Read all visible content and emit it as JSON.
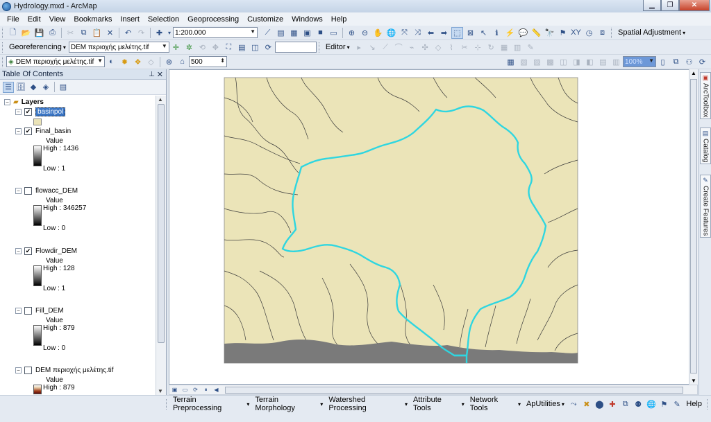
{
  "window": {
    "title": "Hydrology.mxd - ArcMap"
  },
  "menu": [
    "File",
    "Edit",
    "View",
    "Bookmarks",
    "Insert",
    "Selection",
    "Geoprocessing",
    "Customize",
    "Windows",
    "Help"
  ],
  "toolbar": {
    "scale": "1:200.000",
    "spatial_adjustment": "Spatial Adjustment",
    "georeferencing": "Georeferencing",
    "georef_layer": "DEM περιοχής μελέτης.tif",
    "editor": "Editor",
    "active_layer": "DEM περιοχής μελέτης.tif",
    "contour_interval": "500",
    "zoom_value": "100%"
  },
  "toc": {
    "title": "Table Of Contents",
    "root": "Layers",
    "layers": [
      {
        "name": "basinpol",
        "checked": true
      },
      {
        "name": "Final_basin",
        "checked": true,
        "value_label": "Value",
        "high": "High : 1436",
        "low": "Low : 1"
      },
      {
        "name": "flowacc_DEM",
        "checked": false,
        "value_label": "Value",
        "high": "High : 346257",
        "low": "Low : 0"
      },
      {
        "name": "Flowdir_DEM",
        "checked": true,
        "value_label": "Value",
        "high": "High : 128",
        "low": "Low : 1"
      },
      {
        "name": "Fill_DEM",
        "checked": false,
        "value_label": "Value",
        "high": "High : 879",
        "low": "Low : 0"
      },
      {
        "name": "DEM περιοχής μελέτης.tif",
        "checked": false,
        "value_label": "Value",
        "high": "High : 879"
      }
    ]
  },
  "dock": {
    "tab1": "ArcToolbox",
    "tab2": "Catalog",
    "tab3": "Create Features"
  },
  "hydro_toolbar": [
    "Terrain Preprocessing",
    "Terrain Morphology",
    "Watershed Processing",
    "Attribute Tools",
    "Network Tools",
    "ApUtilities"
  ],
  "help": "Help",
  "colors": {
    "map_bg": "#ebe4b8",
    "basin_outline": "#2fd6e0",
    "stream_line": "#3b3b3b",
    "sea": "#7a7a7a",
    "selection": "#3a75c4"
  }
}
